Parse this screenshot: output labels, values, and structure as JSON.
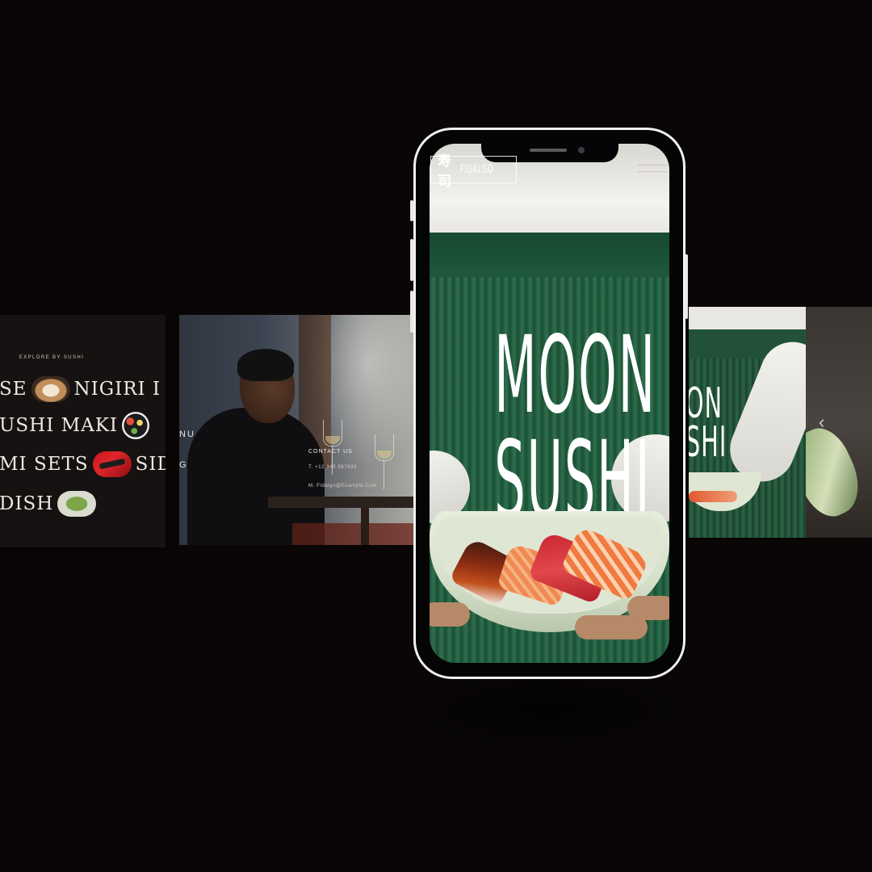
{
  "explore_panel": {
    "heading": "EXPLORE BY SUSHI",
    "rows": [
      {
        "left_word": "SE",
        "thumb": "nigiri-plate",
        "right_word": "NIGIRI I"
      },
      {
        "left_word": "USHI MAKI",
        "thumb": "maki-bowl",
        "right_word": ""
      },
      {
        "left_word": "MI SETS",
        "thumb": "sashimi-tray",
        "right_word": "SIDI"
      },
      {
        "left_word": "DISH",
        "thumb": "side-dish",
        "right_word": ""
      }
    ]
  },
  "restaurant_panel": {
    "menu_partial": "NU",
    "menu_partial_2": "G",
    "contact_title": "CONTACT US",
    "contact_phone": "T. +12 345 567899",
    "contact_mail": "M. Fidalgo@Example.Com"
  },
  "phone": {
    "logo_kanji": "寿司",
    "logo_text": "FIDALGO",
    "hero_title_line1": "MOON",
    "hero_title_line2": "SUSHI",
    "menu_icon": "hamburger-menu-icon"
  },
  "right_panel": {
    "title_partial_1": "ON",
    "title_partial_2": "SHI"
  },
  "far_panel": {
    "arrow_icon": "chevron-left-icon",
    "arrow_glyph": "‹"
  },
  "colors": {
    "background": "#0a0606",
    "apron_green": "#1f5a3c",
    "phone_frame": "#f1f1f1",
    "plate": "#dfe7d4"
  }
}
